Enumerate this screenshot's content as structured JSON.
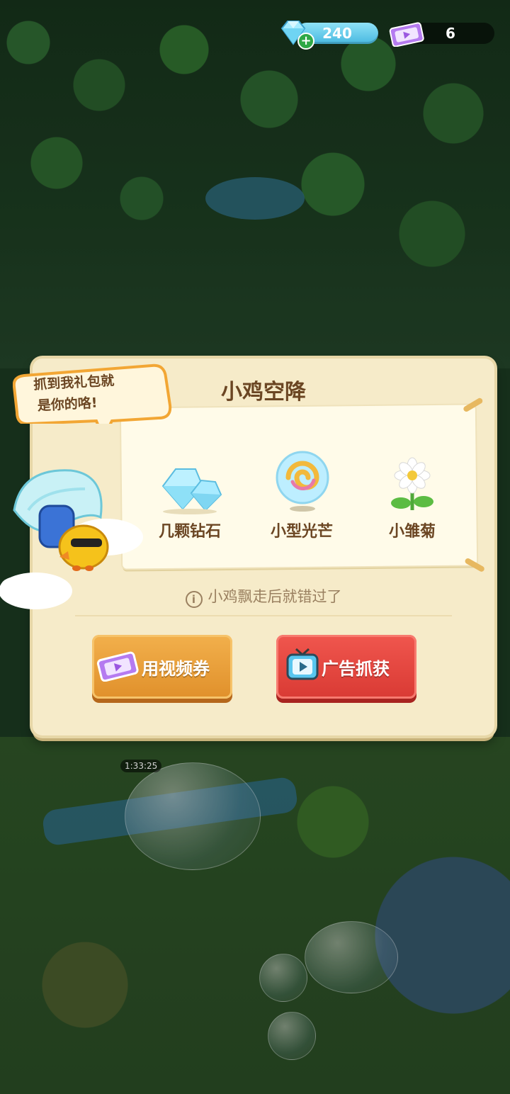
{
  "resources": {
    "gems": "240",
    "video_tickets": "6"
  },
  "background": {
    "timer": "1:33:25"
  },
  "dialog": {
    "title": "小鸡空降",
    "speech": [
      "抓到我礼包就",
      "是你的咯!"
    ],
    "rewards": [
      {
        "label": "几颗钻石",
        "icon": "diamond-cluster-icon"
      },
      {
        "label": "小型光芒",
        "icon": "light-orb-icon"
      },
      {
        "label": "小雏菊",
        "icon": "daisy-icon"
      }
    ],
    "note": "小鸡飘走后就错过了",
    "buttons": {
      "ticket": "用视频券",
      "ad": "广告抓获"
    }
  },
  "colors": {
    "panel": "#f6ebc9",
    "title_text": "#6b4623",
    "ticket_button": "#e89a33",
    "ad_button": "#e0453f"
  }
}
